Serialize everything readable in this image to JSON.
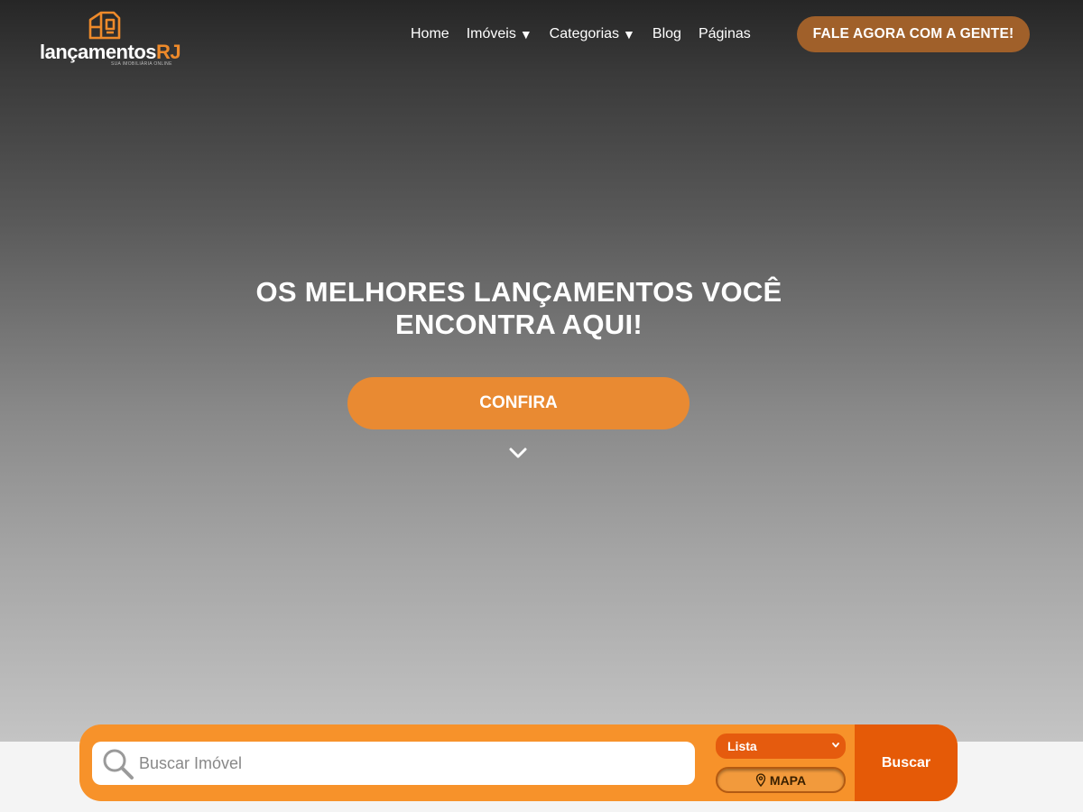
{
  "brand": {
    "name_main": "lançamentos",
    "name_accent": "RJ",
    "tagline": "SUA IMOBILIÁRIA ONLINE",
    "accent_color": "#ee8a2a"
  },
  "nav": {
    "items": [
      {
        "label": "Home",
        "dropdown": false
      },
      {
        "label": "Imóveis",
        "dropdown": true
      },
      {
        "label": "Categorias",
        "dropdown": true
      },
      {
        "label": "Blog",
        "dropdown": false
      },
      {
        "label": "Páginas",
        "dropdown": false
      }
    ],
    "dropdown_caret": "▼",
    "cta_label": "FALE AGORA COM A GENTE!",
    "cta_color": "#a0602a"
  },
  "hero": {
    "headline_line1": "OS MELHORES LANÇAMENTOS VOCÊ",
    "headline_line2": "ENCONTRA AQUI!",
    "button_label": "CONFIRA",
    "button_color": "#e98a32",
    "scroll_icon": "chevron-down-icon"
  },
  "search": {
    "placeholder": "Buscar Imóvel",
    "value": "",
    "view_selected": "Lista",
    "map_label": "MAPA",
    "submit_label": "Buscar",
    "bar_color": "#f7922a",
    "submit_color": "#e55a07",
    "icons": [
      "search-icon",
      "map-pin-icon",
      "chevron-down-icon"
    ]
  }
}
